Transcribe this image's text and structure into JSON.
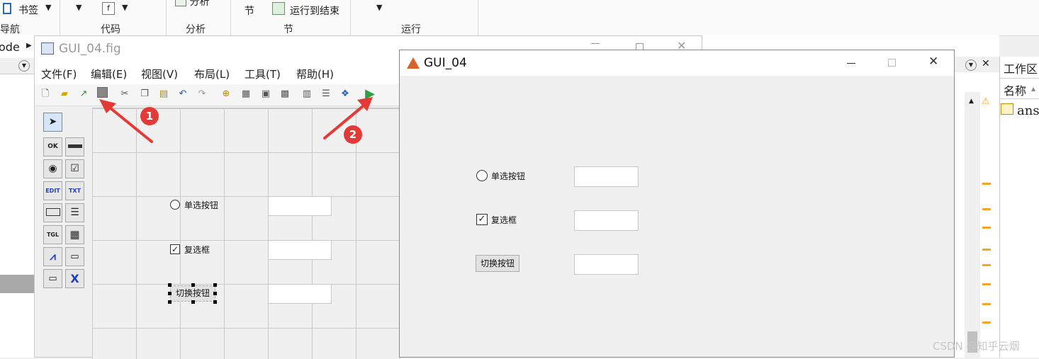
{
  "ribbon": {
    "bookmark_label": "书签",
    "nav_label": "导航",
    "code_label": "代码",
    "analyze_top": "分析",
    "analyze_label": "分析",
    "section_item": "节",
    "run_to_end": "运行到结束",
    "section_label": "节",
    "run_label": "运行"
  },
  "left": {
    "path_fragment": "ode"
  },
  "guide": {
    "title": "GUI_04.fig",
    "menu": [
      "文件(F)",
      "编辑(E)",
      "视图(V)",
      "布局(L)",
      "工具(T)",
      "帮助(H)"
    ],
    "palette": [
      "OK",
      "",
      "◉",
      "☑",
      "EDIT",
      "TXT",
      "",
      "",
      "TGL",
      "",
      "",
      "",
      "",
      "X"
    ],
    "radio_label": "单选按钮",
    "check_label": "复选框",
    "toggle_label": "切换按钮"
  },
  "annotations": {
    "badge1": "1",
    "badge2": "2"
  },
  "figure": {
    "title": "GUI_04",
    "radio_label": "单选按钮",
    "check_label": "复选框",
    "toggle_label": "切换按钮"
  },
  "workspace": {
    "title": "工作区",
    "col_name": "名称",
    "var_name": "ans"
  },
  "watermark": "CSDN @知乎云烟",
  "colors": {
    "accent_red": "#e53935",
    "run_green": "#2ea043",
    "warn_orange": "#f5a623"
  }
}
